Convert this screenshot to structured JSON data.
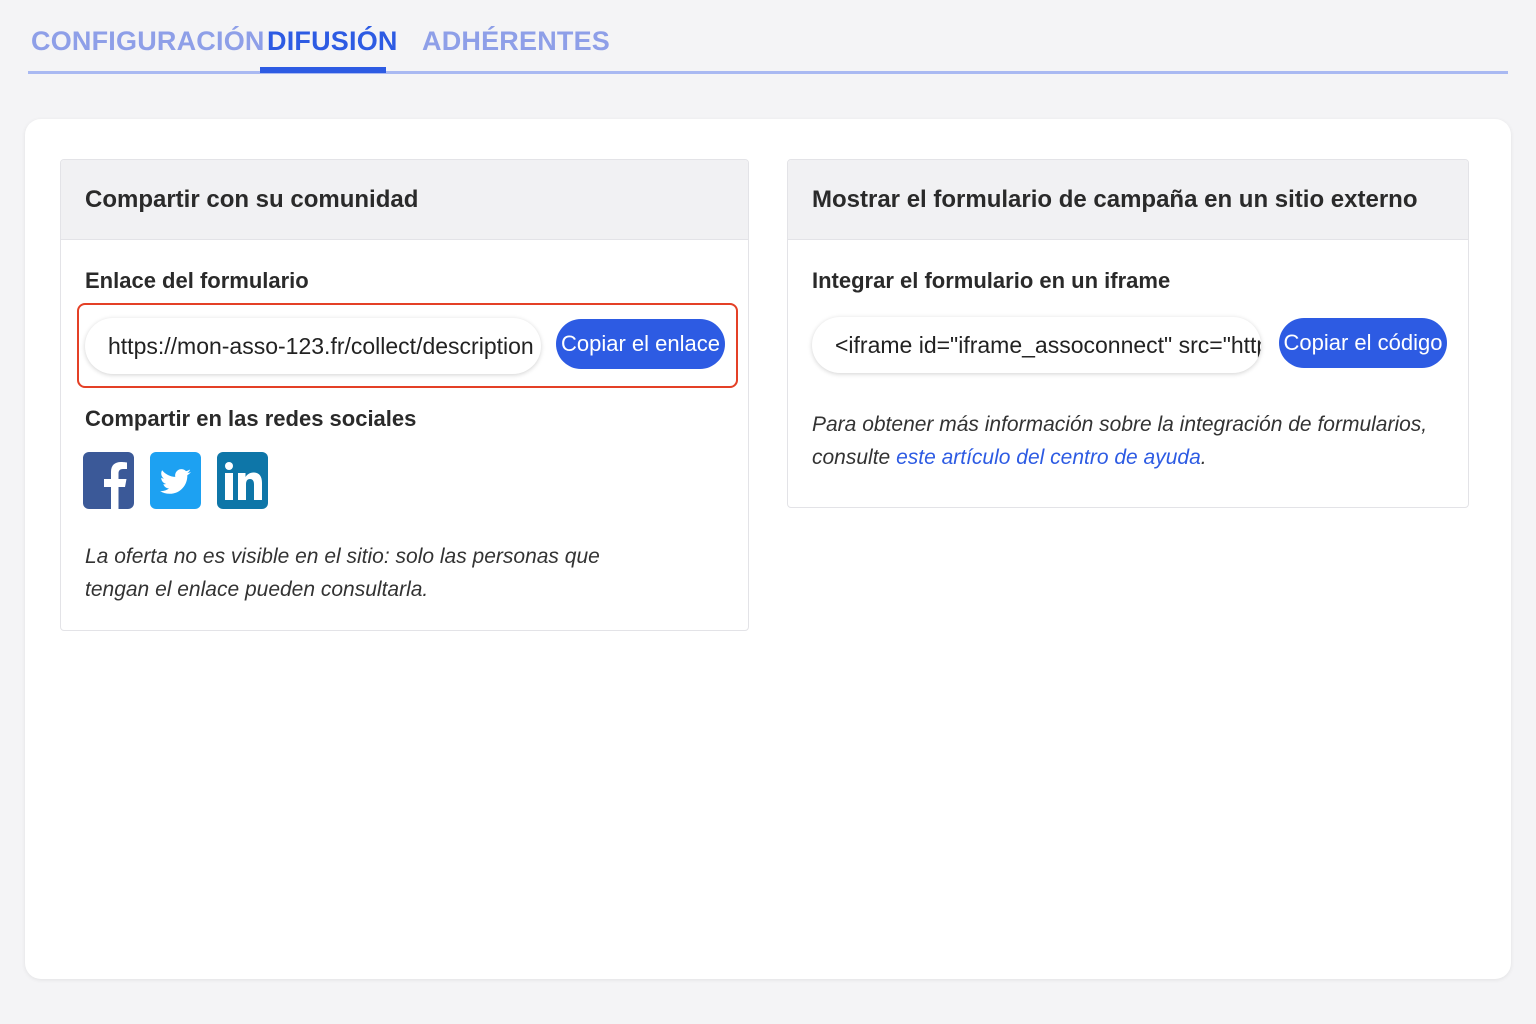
{
  "tabs": [
    {
      "label": "CONFIGURACIÓN",
      "active": false
    },
    {
      "label": "DIFUSIÓN",
      "active": true
    },
    {
      "label": "ADHÉRENTES",
      "active": false
    }
  ],
  "share_card": {
    "title": "Compartir con su comunidad",
    "link_label": "Enlace del formulario",
    "link_value": "https://mon-asso-123.fr/collect/description",
    "copy_button": "Copiar el enlace",
    "social_label": "Compartir en las redes sociales",
    "social_icons": [
      "facebook-icon",
      "twitter-icon",
      "linkedin-icon"
    ],
    "note_line1": "La oferta no es visible en el sitio: solo las personas que",
    "note_line2": "tengan el enlace pueden consultarla."
  },
  "embed_card": {
    "title": "Mostrar el formulario de campaña en un sitio externo",
    "iframe_label": "Integrar el formulario en un iframe",
    "iframe_value": "<iframe id=\"iframe_assoconnect\" src=\"http",
    "copy_button": "Copiar el código",
    "help_line1": "Para obtener más información sobre la integración de formularios,",
    "help_prefix": "consulte ",
    "help_link": "este artículo del centro de ayuda",
    "help_suffix": "."
  },
  "colors": {
    "accent": "#2d5be3",
    "tab_inactive": "#8e9fe8",
    "highlight": "#e44026",
    "facebook": "#3b5998",
    "twitter": "#1da1f2",
    "linkedin": "#0e76a8"
  }
}
